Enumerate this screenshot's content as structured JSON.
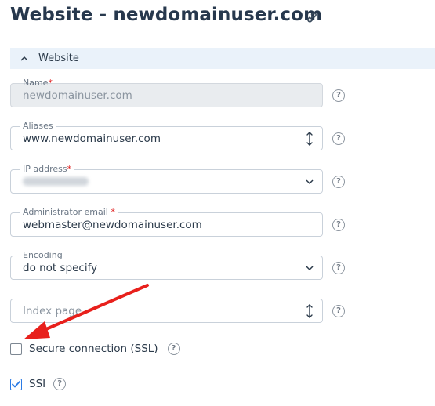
{
  "page": {
    "title": "Website - newdomainuser.com",
    "link_icon": "link-icon"
  },
  "section": {
    "label": "Website",
    "toggle_icon": "chevron-up-icon"
  },
  "fields": {
    "name": {
      "label": "Name",
      "required": "*",
      "value": "newdomainuser.com",
      "disabled": true
    },
    "aliases": {
      "label": "Aliases",
      "value": "www.newdomainuser.com"
    },
    "ip_address": {
      "label": "IP address",
      "required": "*",
      "value_obscured": true
    },
    "admin_email": {
      "label": "Administrator email",
      "required": " *",
      "value": "webmaster@newdomainuser.com"
    },
    "encoding": {
      "label": "Encoding",
      "value": "do not specify"
    },
    "index_page": {
      "placeholder": "Index page"
    }
  },
  "help_text": "?",
  "checkboxes": {
    "ssl": {
      "label": "Secure connection (SSL)",
      "checked": false
    },
    "ssi": {
      "label": "SSI",
      "checked": true
    }
  },
  "annotation": {
    "color": "#e8201c"
  },
  "colors": {
    "accent": "#2c7be5",
    "section_bg": "#eaf2fa",
    "title": "#27384d"
  }
}
